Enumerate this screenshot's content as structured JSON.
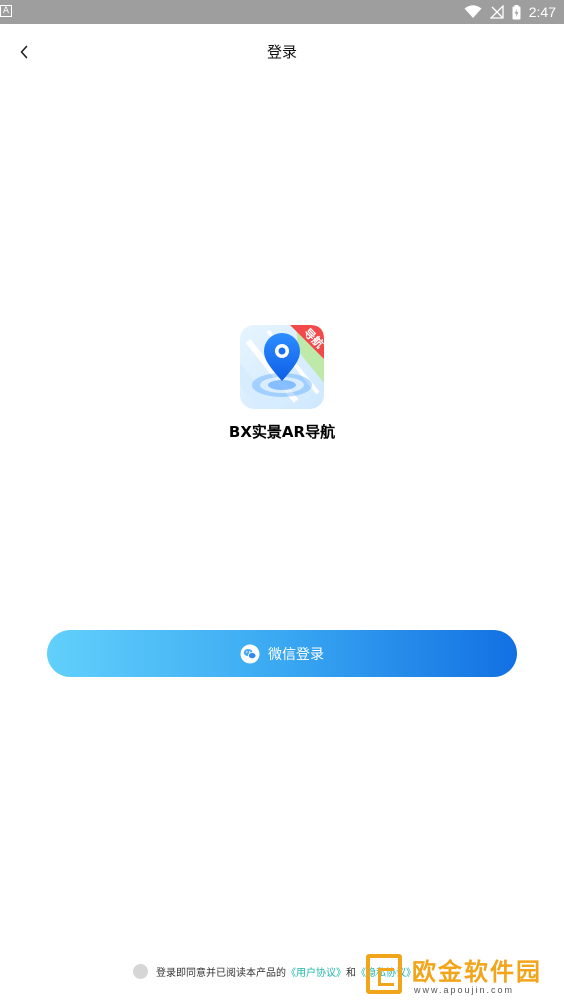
{
  "status_bar": {
    "left_indicator": "A",
    "time": "2:47",
    "icons": [
      "wifi-icon",
      "signal-icon",
      "battery-icon"
    ]
  },
  "header": {
    "title": "登录",
    "back_icon": "chevron-left-icon"
  },
  "app": {
    "name": "BX实景AR导航",
    "logo_badge": "导航"
  },
  "login": {
    "wechat_label": "微信登录",
    "wechat_icon": "wechat-icon"
  },
  "agreement": {
    "prefix": "登录即同意并已阅读本产品的",
    "user_agreement": "《用户协议》",
    "joiner": "和",
    "privacy_agreement": "《隐私协议》"
  },
  "watermark": {
    "title": "欧金软件园",
    "subtitle": "www.apoujin.com"
  },
  "colors": {
    "status_bar": "#9e9e9e",
    "button_start": "#62d0fb",
    "button_end": "#1270e3",
    "link": "#1fb6a8",
    "watermark": "#f2a51a"
  }
}
